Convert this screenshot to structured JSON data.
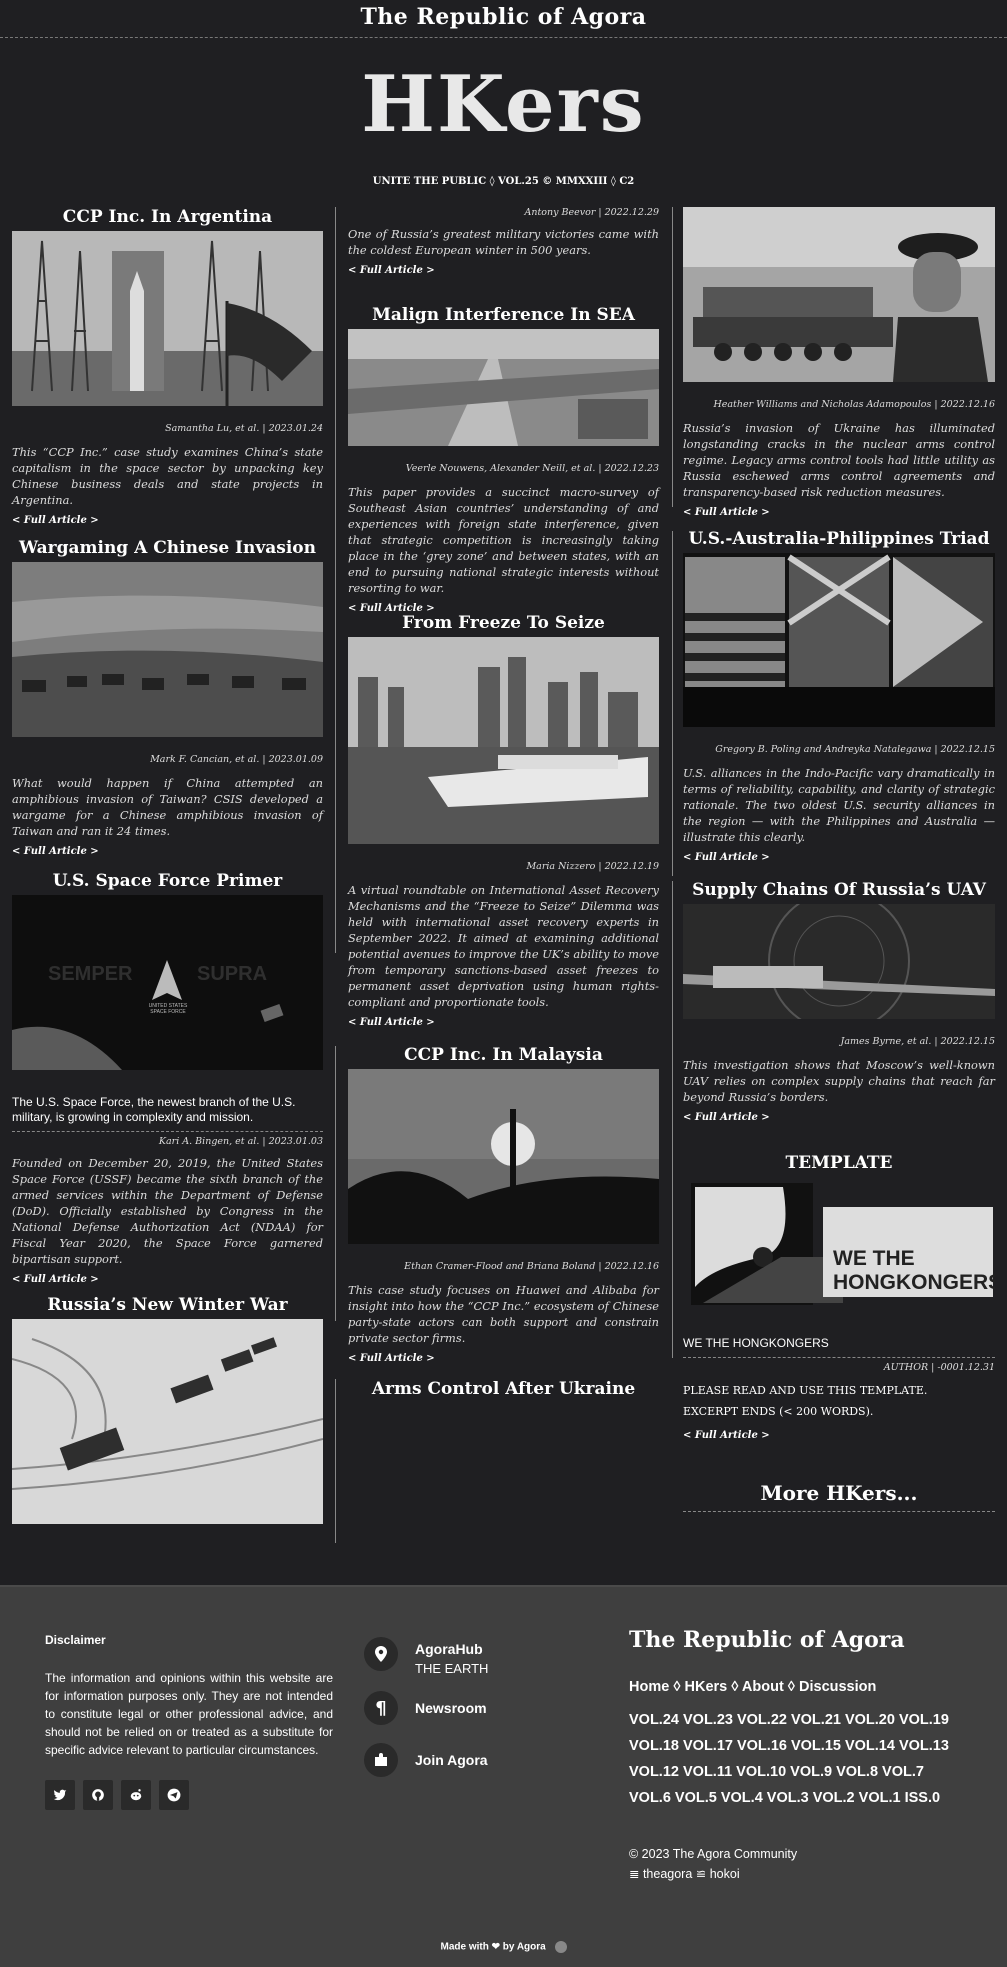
{
  "masthead": {
    "title": "The Republic of Agora",
    "logo": "HKers",
    "tagline": "UNITE THE PUBLIC ◊ VOL.25 © MMXXIII ◊ C2"
  },
  "full_article_label": "< Full Article >",
  "col1": [
    {
      "title": "CCP Inc. In Argentina",
      "meta": "Samantha Lu, et al. | 2023.01.24",
      "excerpt": "This “CCP Inc.” case study examines China’s state capitalism in the space sector by unpacking key Chinese business deals and state projects in Argentina."
    },
    {
      "title": "Wargaming A Chinese Invasion",
      "meta": "Mark F. Cancian, et al. | 2023.01.09",
      "excerpt": "What would happen if China attempted an amphibious invasion of Taiwan? CSIS developed a wargame for a Chinese amphibious invasion of Taiwan and ran it 24 times."
    },
    {
      "title": "U.S. Space Force Primer",
      "img_text": {
        "left": "SEMPER",
        "right": "SUPRA",
        "logo": "UNITED STATES SPACE FORCE"
      },
      "subtitle": "The U.S. Space Force, the newest branch of the U.S. military, is growing in complexity and mission.",
      "meta": "Kari A. Bingen, et al. | 2023.01.03",
      "excerpt": "Founded on December 20, 2019, the United States Space Force (USSF) became the sixth branch of the armed services within the Department of Defense (DoD). Officially established by Congress in the National Defense Authorization Act (NDAA) for Fiscal Year 2020, the Space Force garnered bipartisan support."
    },
    {
      "title": "Russia’s New Winter War"
    }
  ],
  "col2": [
    {
      "meta": "Antony Beevor | 2022.12.29",
      "excerpt": "One of Russia’s greatest military victories came with the coldest European winter in 500 years."
    },
    {
      "title": "Malign Interference In SEA",
      "meta": "Veerle Nouwens, Alexander Neill, et al. | 2022.12.23",
      "excerpt": "This paper provides a succinct macro-survey of Southeast Asian countries’ understanding of and experiences with foreign state interference, given that strategic competition is increasingly taking place in the ‘grey zone’ and between states, with an end to pursuing national strategic interests without resorting to war."
    },
    {
      "title": "From Freeze To Seize",
      "meta": "Maria Nizzero | 2022.12.19",
      "excerpt": "A virtual roundtable on International Asset Recovery Mechanisms and the “Freeze to Seize” Dilemma was held with international asset recovery experts in September 2022. It aimed at examining additional potential avenues to improve the UK’s ability to move from temporary sanctions-based asset freezes to permanent asset deprivation using human rights-compliant and proportionate tools."
    },
    {
      "title": "CCP Inc. In Malaysia",
      "meta": "Ethan Cramer-Flood and Briana Boland | 2022.12.16",
      "excerpt": "This case study focuses on Huawei and Alibaba for insight into how the “CCP Inc.” ecosystem of Chinese party-state actors can both support and constrain private sector firms."
    },
    {
      "title": "Arms Control After Ukraine"
    }
  ],
  "col3": [
    {
      "meta": "Heather Williams and Nicholas Adamopoulos | 2022.12.16",
      "excerpt": "Russia’s invasion of Ukraine has illuminated longstanding cracks in the nuclear arms control regime. Legacy arms control tools had little utility as Russia eschewed arms control agreements and transparency-based risk reduction measures."
    },
    {
      "title": "U.S.-Australia-Philippines Triad",
      "meta": "Gregory B. Poling and Andreyka Natalegawa | 2022.12.15",
      "excerpt": "U.S. alliances in the Indo-Pacific vary dramatically in terms of reliability, capability, and clarity of strategic rationale. The two oldest U.S. security alliances in the region — with the Philippines and Australia — illustrate this clearly."
    },
    {
      "title": "Supply Chains Of Russia’s UAV",
      "meta": "James Byrne, et al. | 2022.12.15",
      "excerpt": "This investigation shows that Moscow’s well-known UAV relies on complex supply chains that reach far beyond Russia’s borders."
    },
    {
      "title": "TEMPLATE",
      "img_text": "WE THE HONGKONGERS",
      "subtitle": "WE THE HONGKONGERS",
      "meta": "AUTHOR | -0001.12.31",
      "line1": "PLEASE READ AND USE THIS TEMPLATE.",
      "line2": "EXCERPT ENDS (< 200 WORDS)."
    }
  ],
  "more": "More HKers...",
  "footer": {
    "disclaimer_title": "Disclaimer",
    "disclaimer_text": "The information and opinions within this website are for information purposes only. They are not intended to constitute legal or other professional advice, and should not be relied on or treated as a substitute for specific advice relevant to particular circumstances.",
    "social_icons": [
      "twitter-icon",
      "github-icon",
      "reddit-icon",
      "telegram-icon"
    ],
    "hub": {
      "label": "AgoraHub",
      "sub": "THE EARTH"
    },
    "newsroom": "Newsroom",
    "join": "Join Agora",
    "republic": "The Republic of Agora",
    "nav": "Home ◊ HKers ◊ About ◊ Discussion",
    "volumes": "VOL.24  VOL.23  VOL.22  VOL.21  VOL.20  VOL.19  VOL.18  VOL.17  VOL.16  VOL.15  VOL.14 VOL.13 VOL.12 VOL.11 VOL.10 VOL.9 VOL.8 VOL.7 VOL.6 VOL.5 VOL.4 VOL.3 VOL.2 VOL.1 ISS.0",
    "copyright": "© 2023 The Agora Community",
    "links": "≣ theagora ≌ hokoi",
    "made_with": "Made with ❤ by Agora"
  }
}
